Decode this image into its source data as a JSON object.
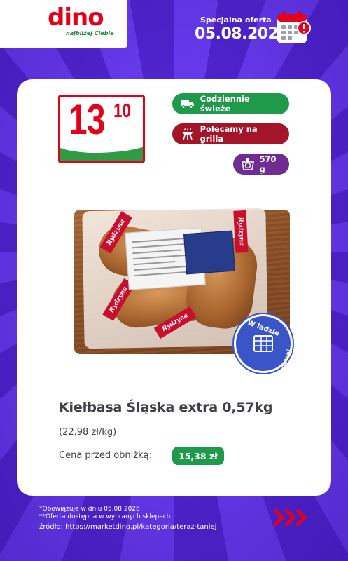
{
  "header": {
    "logo_text": "dino",
    "logo_tagline": "najbliżej Ciebie",
    "offer_label": "Specjalna oferta",
    "offer_date": "05.08.2026"
  },
  "price": {
    "main": "13",
    "cents": "10"
  },
  "tags": [
    {
      "label": "Codziennie świeże",
      "icon": "truck-icon",
      "color": "#1f9a4b"
    },
    {
      "label": "Polecamy na grilla",
      "icon": "grill-icon",
      "color": "#a4152a"
    },
    {
      "label": "570 g",
      "icon": "scale-icon",
      "color": "#6f2c91"
    }
  ],
  "package": {
    "brand_text": "Rydzyna"
  },
  "badge": {
    "top": "W ladzie",
    "bottom": "samoobsługowej"
  },
  "product": {
    "name": "Kiełbasa Śląska extra 0,57kg",
    "unit_price": "(22,98 zł/kg)",
    "previous_label": "Cena przed obniżką:",
    "previous_price": "15,38 zł"
  },
  "footer": {
    "note1": "*Obowiązuje w dniu 05.08.2026",
    "note2": "**Oferta dostępna w wybranych sklepach",
    "source": "źródło: https://marketdino.pl/kategoria/teraz-taniej"
  },
  "colors": {
    "background": "#5a2bd8",
    "brand_red": "#e2001a",
    "green": "#1f9a4b"
  }
}
